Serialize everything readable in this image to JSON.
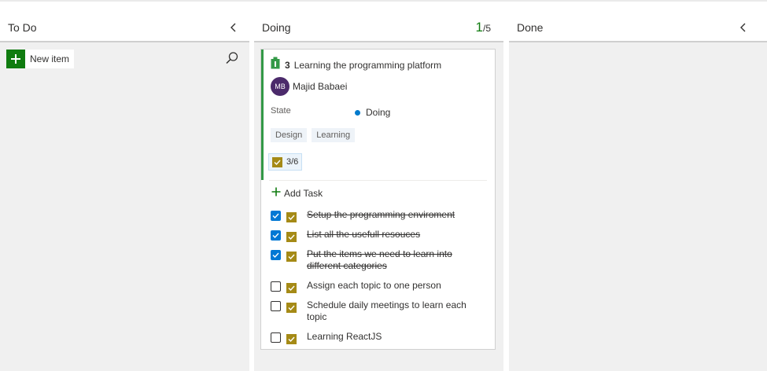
{
  "columns": {
    "todo": {
      "title": "To Do",
      "new_item_label": "New item"
    },
    "doing": {
      "title": "Doing",
      "wip_current": "1",
      "wip_max": "/5"
    },
    "done": {
      "title": "Done"
    }
  },
  "icons": {
    "collapse": "chevron-left-icon",
    "search": "search-icon",
    "add": "plus-icon",
    "work_item": "backlog-item-icon",
    "task": "task-check-icon"
  },
  "colors": {
    "accent_green": "#107c10",
    "card_bar": "#339947",
    "state_doing": "#007acc",
    "task_icon": "#a58a16",
    "checkbox_checked": "#0078d4",
    "avatar_bg": "#4b2a6b"
  },
  "card": {
    "id": "3",
    "title": "Learning the programming platform",
    "assignee": {
      "initials": "MB",
      "name": "Majid Babaei"
    },
    "state_label": "State",
    "state_value": "Doing",
    "tags": [
      "Design",
      "Learning"
    ],
    "progress": "3/6",
    "add_task_label": "Add Task",
    "tasks": [
      {
        "label": "Setup the programming enviroment",
        "done": true
      },
      {
        "label": "List all the usefull resouces",
        "done": true
      },
      {
        "label": "Put the items we need to learn into different categories",
        "done": true
      },
      {
        "label": "Assign each topic to one person",
        "done": false
      },
      {
        "label": "Schedule daily meetings to learn each topic",
        "done": false
      },
      {
        "label": "Learning ReactJS",
        "done": false
      }
    ]
  }
}
